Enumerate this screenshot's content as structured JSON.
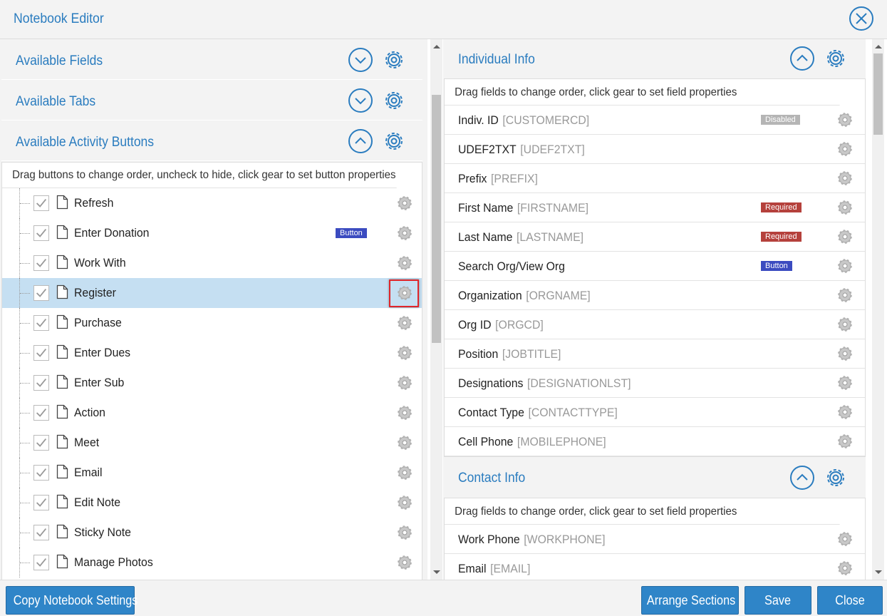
{
  "window": {
    "title": "Notebook Editor"
  },
  "left": {
    "sections": [
      {
        "title": "Available Fields",
        "state": "collapsed"
      },
      {
        "title": "Available Tabs",
        "state": "collapsed"
      },
      {
        "title": "Available Activity Buttons",
        "state": "expanded"
      }
    ],
    "hint": "Drag buttons to change order, uncheck to hide, click gear to set button properties",
    "buttons": [
      {
        "label": "Refresh",
        "checked": true
      },
      {
        "label": "Enter Donation",
        "checked": true,
        "badge": "Button"
      },
      {
        "label": "Work With",
        "checked": true
      },
      {
        "label": "Register",
        "checked": true,
        "selected": true
      },
      {
        "label": "Purchase",
        "checked": true
      },
      {
        "label": "Enter Dues",
        "checked": true
      },
      {
        "label": "Enter Sub",
        "checked": true
      },
      {
        "label": "Action",
        "checked": true
      },
      {
        "label": "Meet",
        "checked": true
      },
      {
        "label": "Email",
        "checked": true
      },
      {
        "label": "Edit Note",
        "checked": true
      },
      {
        "label": "Sticky Note",
        "checked": true
      },
      {
        "label": "Manage Photos",
        "checked": true
      }
    ]
  },
  "right": {
    "sections": [
      {
        "title": "Individual Info",
        "hint": "Drag fields to change order, click gear to set field properties",
        "fields": [
          {
            "name": "Indiv. ID",
            "code": "[CUSTOMERCD]",
            "badge": "Disabled",
            "badge_type": "disabled"
          },
          {
            "name": "UDEF2TXT",
            "code": "[UDEF2TXT]"
          },
          {
            "name": "Prefix",
            "code": "[PREFIX]"
          },
          {
            "name": "First Name",
            "code": "[FIRSTNAME]",
            "badge": "Required",
            "badge_type": "required"
          },
          {
            "name": "Last Name",
            "code": "[LASTNAME]",
            "badge": "Required",
            "badge_type": "required"
          },
          {
            "name": "Search Org/View Org",
            "code": "",
            "badge": "Button",
            "badge_type": "button"
          },
          {
            "name": "Organization",
            "code": "[ORGNAME]"
          },
          {
            "name": "Org ID",
            "code": "[ORGCD]"
          },
          {
            "name": "Position",
            "code": "[JOBTITLE]"
          },
          {
            "name": "Designations",
            "code": "[DESIGNATIONLST]"
          },
          {
            "name": "Contact Type",
            "code": "[CONTACTTYPE]"
          },
          {
            "name": "Cell Phone",
            "code": "[MOBILEPHONE]"
          }
        ]
      },
      {
        "title": "Contact Info",
        "hint": "Drag fields to change order, click gear to set field properties",
        "fields": [
          {
            "name": "Work Phone",
            "code": "[WORKPHONE]"
          },
          {
            "name": "Email",
            "code": "[EMAIL]"
          }
        ]
      }
    ]
  },
  "footer": {
    "copy_label": "Copy Notebook Settings",
    "arrange_label": "Arrange Sections",
    "save_label": "Save",
    "close_label": "Close"
  },
  "colors": {
    "accent": "#2a7cbf",
    "button": "#2f85c8",
    "selected_row": "#c5dff2",
    "required": "#b5413c",
    "badge_button": "#3b4bc0",
    "disabled": "#b5b5b5"
  }
}
